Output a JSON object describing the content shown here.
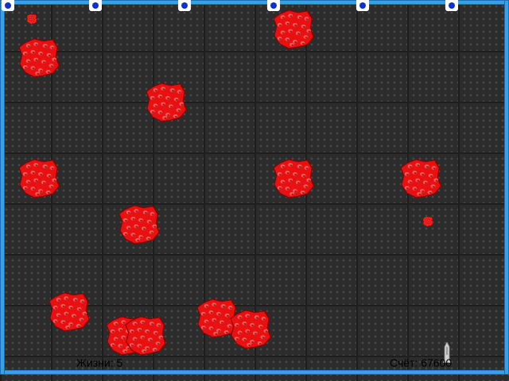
{
  "hud": {
    "lives_text": "Жизни: 5",
    "score_text": "Счёт: 67600"
  },
  "colors": {
    "frame": "#3a9fe6",
    "asteroid": "#e81010",
    "asteroid_highlight": "#ff6a6a",
    "turret_body": "#ffffff",
    "turret_core": "#1230c8",
    "background": "#2c2c2c"
  },
  "icons": {
    "asteroid": "asteroid-icon",
    "turret": "turret-icon",
    "ship": "ship-icon"
  }
}
